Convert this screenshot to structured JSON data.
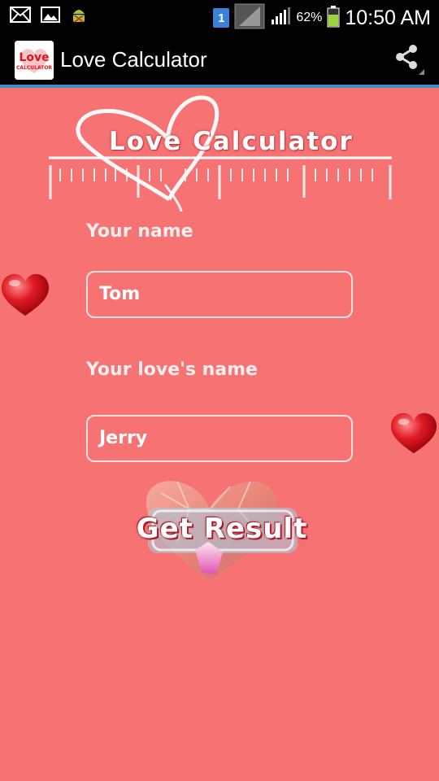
{
  "status_bar": {
    "notification_icons": [
      "mail-icon",
      "image-icon",
      "android-debug-icon"
    ],
    "sim_slot": "1",
    "battery_percent": "62%",
    "time": "10:50 AM"
  },
  "action_bar": {
    "title": "Love Calculator",
    "app_icon_text_top": "Love",
    "app_icon_text_bottom": "CALCULATOR",
    "share_icon": "share-icon"
  },
  "logo": {
    "text": "Love Calculator"
  },
  "form": {
    "your_name_label": "Your name",
    "your_name_value": "Tom",
    "love_name_label": "Your love's name",
    "love_name_value": "Jerry"
  },
  "button": {
    "label": "Get Result"
  },
  "colors": {
    "background": "#f77272",
    "action_bar": "#000000",
    "accent_line": "#3d8fc6",
    "heart": "#d8101c"
  }
}
